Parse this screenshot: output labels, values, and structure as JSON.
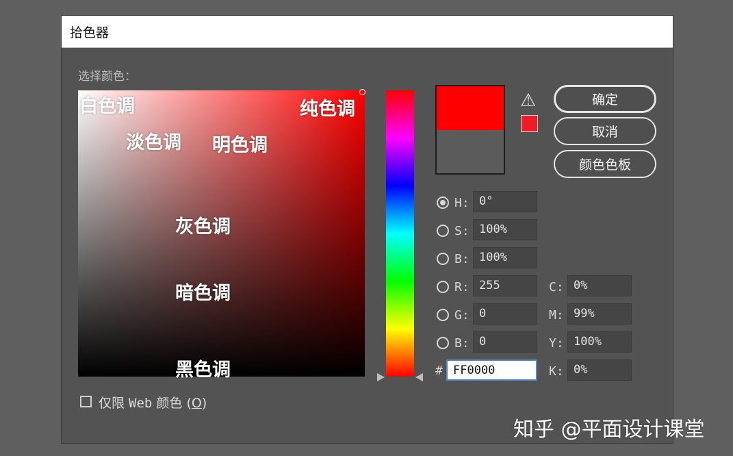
{
  "dialog": {
    "title": "拾色器",
    "select_label": "选择颜色："
  },
  "color_field": {
    "labels": {
      "white": "白色调",
      "pure": "纯色调",
      "pale": "淡色调",
      "bright": "明色调",
      "gray": "灰色调",
      "dark": "暗色调",
      "black": "黑色调"
    }
  },
  "preview": {
    "new_color": "#ff0000",
    "old_color": "#5b5b5b",
    "warning_icon": "warning-triangle-icon",
    "warning_swatch_color": "#ee1c25"
  },
  "buttons": {
    "ok": "确定",
    "cancel": "取消",
    "swatches": "颜色色板"
  },
  "hsb": {
    "h_label": "H:",
    "h_value": "0°",
    "s_label": "S:",
    "s_value": "100%",
    "b_label": "B:",
    "b_value": "100%"
  },
  "rgb": {
    "r_label": "R:",
    "r_value": "255",
    "g_label": "G:",
    "g_value": "0",
    "b_label": "B:",
    "b_value": "0"
  },
  "cmyk": {
    "c_label": "C:",
    "c_value": "0%",
    "m_label": "M:",
    "m_value": "99%",
    "y_label": "Y:",
    "y_value": "100%",
    "k_label": "K:",
    "k_value": "0%"
  },
  "hex": {
    "label": "#",
    "value": "FF0000"
  },
  "web_only": {
    "label_prefix": "仅限 ",
    "label_mono": "Web",
    "label_suffix": " 颜色 (",
    "shortcut": "O",
    "label_end": ")"
  },
  "watermark": "知乎 @平面设计课堂"
}
